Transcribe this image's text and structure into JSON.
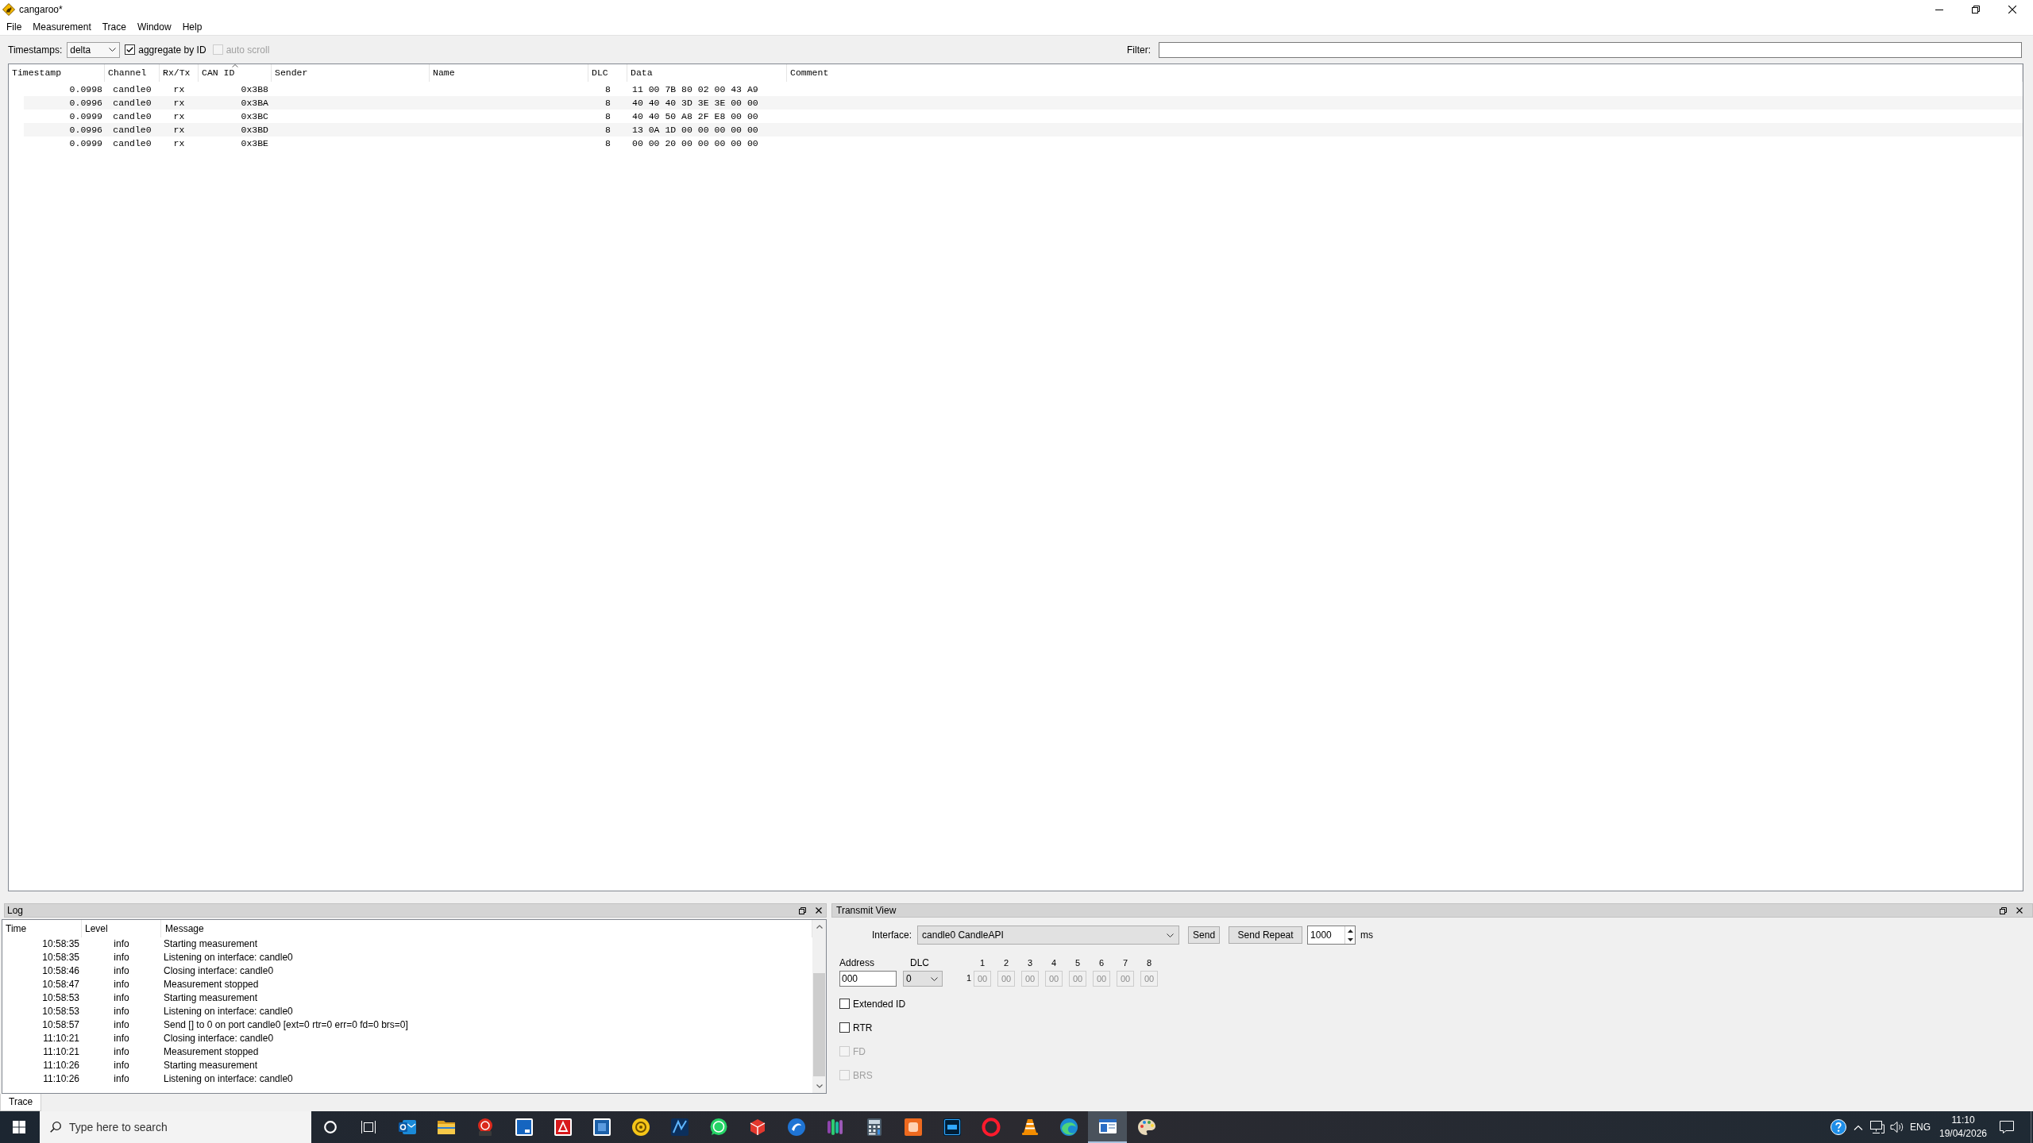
{
  "window": {
    "title": "cangaroo*"
  },
  "menu": [
    "File",
    "Measurement",
    "Trace",
    "Window",
    "Help"
  ],
  "toolbar": {
    "timestamps_label": "Timestamps:",
    "timestamps_value": "delta",
    "options": [
      {
        "label": "aggregate by ID",
        "checked": true,
        "disabled": false
      },
      {
        "label": "auto scroll",
        "checked": false,
        "disabled": true
      }
    ],
    "filter_label": "Filter:"
  },
  "trace_table": {
    "columns": [
      {
        "label": "Timestamp",
        "sorted": false
      },
      {
        "label": "Channel",
        "sorted": false
      },
      {
        "label": "Rx/Tx",
        "sorted": false
      },
      {
        "label": "CAN ID",
        "sorted": true
      },
      {
        "label": "Sender",
        "sorted": false
      },
      {
        "label": "Name",
        "sorted": false
      },
      {
        "label": "DLC",
        "sorted": false
      },
      {
        "label": "Data",
        "sorted": false
      },
      {
        "label": "Comment",
        "sorted": false
      }
    ],
    "rows": [
      {
        "timestamp": "0.0998",
        "channel": "candle0",
        "rx_tx": "rx",
        "can_id": "0x3B8",
        "dlc": "8",
        "data": "11 00 7B 80 02 00 43 A9"
      },
      {
        "timestamp": "0.0996",
        "channel": "candle0",
        "rx_tx": "rx",
        "can_id": "0x3BA",
        "dlc": "8",
        "data": "40 40 40 3D 3E 3E 00 00"
      },
      {
        "timestamp": "0.0999",
        "channel": "candle0",
        "rx_tx": "rx",
        "can_id": "0x3BC",
        "dlc": "8",
        "data": "40 40 50 A8 2F E8 00 00"
      },
      {
        "timestamp": "0.0996",
        "channel": "candle0",
        "rx_tx": "rx",
        "can_id": "0x3BD",
        "dlc": "8",
        "data": "13 0A 1D 00 00 00 00 00"
      },
      {
        "timestamp": "0.0999",
        "channel": "candle0",
        "rx_tx": "rx",
        "can_id": "0x3BE",
        "dlc": "8",
        "data": "00 00 20 00 00 00 00 00"
      }
    ]
  },
  "log": {
    "title": "Log",
    "columns": [
      "Time",
      "Level",
      "Message"
    ],
    "rows": [
      {
        "time": "10:58:35",
        "level": "info",
        "message": "Starting measurement"
      },
      {
        "time": "10:58:35",
        "level": "info",
        "message": "Listening on interface: candle0"
      },
      {
        "time": "10:58:46",
        "level": "info",
        "message": "Closing interface: candle0"
      },
      {
        "time": "10:58:47",
        "level": "info",
        "message": "Measurement stopped"
      },
      {
        "time": "10:58:53",
        "level": "info",
        "message": "Starting measurement"
      },
      {
        "time": "10:58:53",
        "level": "info",
        "message": "Listening on interface: candle0"
      },
      {
        "time": "10:58:57",
        "level": "info",
        "message": "Send [] to 0 on port candle0 [ext=0 rtr=0 err=0 fd=0 brs=0]"
      },
      {
        "time": "11:10:21",
        "level": "info",
        "message": "Closing interface: candle0"
      },
      {
        "time": "11:10:21",
        "level": "info",
        "message": "Measurement stopped"
      },
      {
        "time": "11:10:26",
        "level": "info",
        "message": "Starting measurement"
      },
      {
        "time": "11:10:26",
        "level": "info",
        "message": "Listening on interface: candle0"
      }
    ]
  },
  "transmit": {
    "title": "Transmit View",
    "interface_label": "Interface:",
    "interface_value": "candle0 CandleAPI",
    "buttons": [
      "Send",
      "Send Repeat"
    ],
    "interval_value": "1000",
    "interval_unit": "ms",
    "address_label": "Address",
    "address_value": "000",
    "dlc_label": "DLC",
    "dlc_value": "0",
    "byte_headers": [
      "1",
      "2",
      "3",
      "4",
      "5",
      "6",
      "7",
      "8"
    ],
    "row_label": "1",
    "bytes": [
      {
        "value": "00",
        "disabled": true
      },
      {
        "value": "00",
        "disabled": true
      },
      {
        "value": "00",
        "disabled": true
      },
      {
        "value": "00",
        "disabled": true
      },
      {
        "value": "00",
        "disabled": true
      },
      {
        "value": "00",
        "disabled": true
      },
      {
        "value": "00",
        "disabled": true
      },
      {
        "value": "00",
        "disabled": true
      }
    ],
    "flags": [
      {
        "label": "Extended ID",
        "checked": false,
        "disabled": false
      },
      {
        "label": "RTR",
        "checked": false,
        "disabled": false
      },
      {
        "label": "FD",
        "checked": false,
        "disabled": true
      },
      {
        "label": "BRS",
        "checked": false,
        "disabled": true
      }
    ]
  },
  "tabs": [
    {
      "label": "Trace",
      "selected": true
    }
  ],
  "taskbar": {
    "search": {
      "placeholder": "Type here to search"
    },
    "apps": [
      {
        "kind": "mail",
        "selected": false
      },
      {
        "kind": "folder",
        "selected": false
      },
      {
        "kind": "emblem",
        "selected": false
      },
      {
        "kind": "page",
        "selected": false
      },
      {
        "kind": "document",
        "selected": false
      },
      {
        "kind": "tile",
        "selected": false
      },
      {
        "kind": "disc",
        "selected": false
      },
      {
        "kind": "tile-stripe",
        "selected": false
      },
      {
        "kind": "chat",
        "selected": false
      },
      {
        "kind": "cube",
        "selected": false
      },
      {
        "kind": "swirl",
        "selected": false
      },
      {
        "kind": "bars",
        "selected": false
      },
      {
        "kind": "calculator",
        "selected": false
      },
      {
        "kind": "tile-band",
        "selected": false
      },
      {
        "kind": "tile-frame",
        "selected": false
      },
      {
        "kind": "ring",
        "selected": false
      },
      {
        "kind": "cone",
        "selected": false
      },
      {
        "kind": "wave",
        "selected": false
      },
      {
        "kind": "window",
        "selected": true
      },
      {
        "kind": "palette",
        "selected": false
      }
    ],
    "language": "ENG",
    "time": "11:10",
    "date": "19/04/2026"
  }
}
